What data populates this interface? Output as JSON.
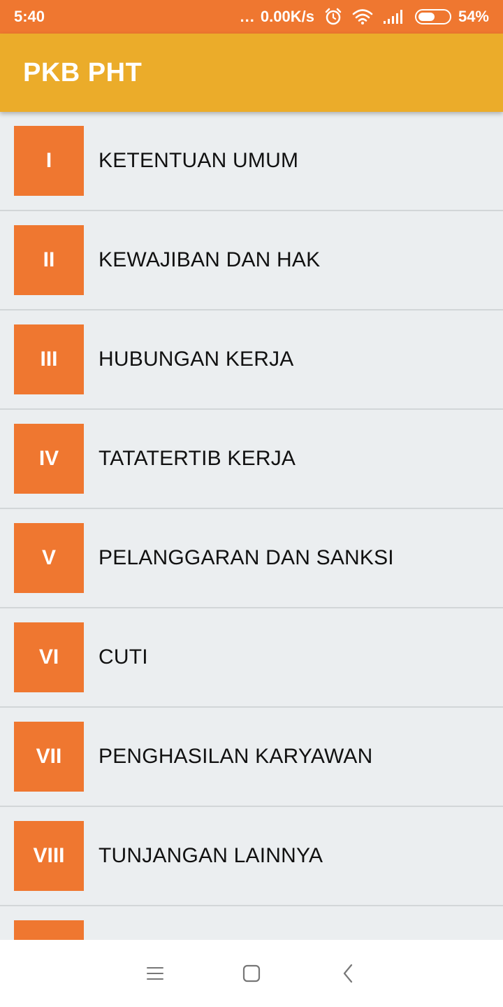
{
  "status_bar": {
    "time": "5:40",
    "dots": "...",
    "network_speed": "0.00K/s",
    "battery_percent": "54%",
    "battery_level": 0.54,
    "icons": [
      "alarm-icon",
      "wifi-icon",
      "signal-icon",
      "battery-icon"
    ]
  },
  "app_bar": {
    "title": "PKB PHT",
    "color": "#EBAC2A"
  },
  "accent_color": "#EF7730",
  "chapters": [
    {
      "numeral": "I",
      "title": "KETENTUAN UMUM"
    },
    {
      "numeral": "II",
      "title": "KEWAJIBAN DAN HAK"
    },
    {
      "numeral": "III",
      "title": "HUBUNGAN KERJA"
    },
    {
      "numeral": "IV",
      "title": "TATATERTIB KERJA"
    },
    {
      "numeral": "V",
      "title": "PELANGGARAN DAN SANKSI"
    },
    {
      "numeral": "VI",
      "title": "CUTI"
    },
    {
      "numeral": "VII",
      "title": "PENGHASILAN KARYAWAN"
    },
    {
      "numeral": "VIII",
      "title": "TUNJANGAN LAINNYA"
    },
    {
      "numeral": "",
      "title": ""
    }
  ],
  "nav_bar": {
    "icons": [
      "menu-icon",
      "home-icon",
      "back-icon"
    ]
  }
}
